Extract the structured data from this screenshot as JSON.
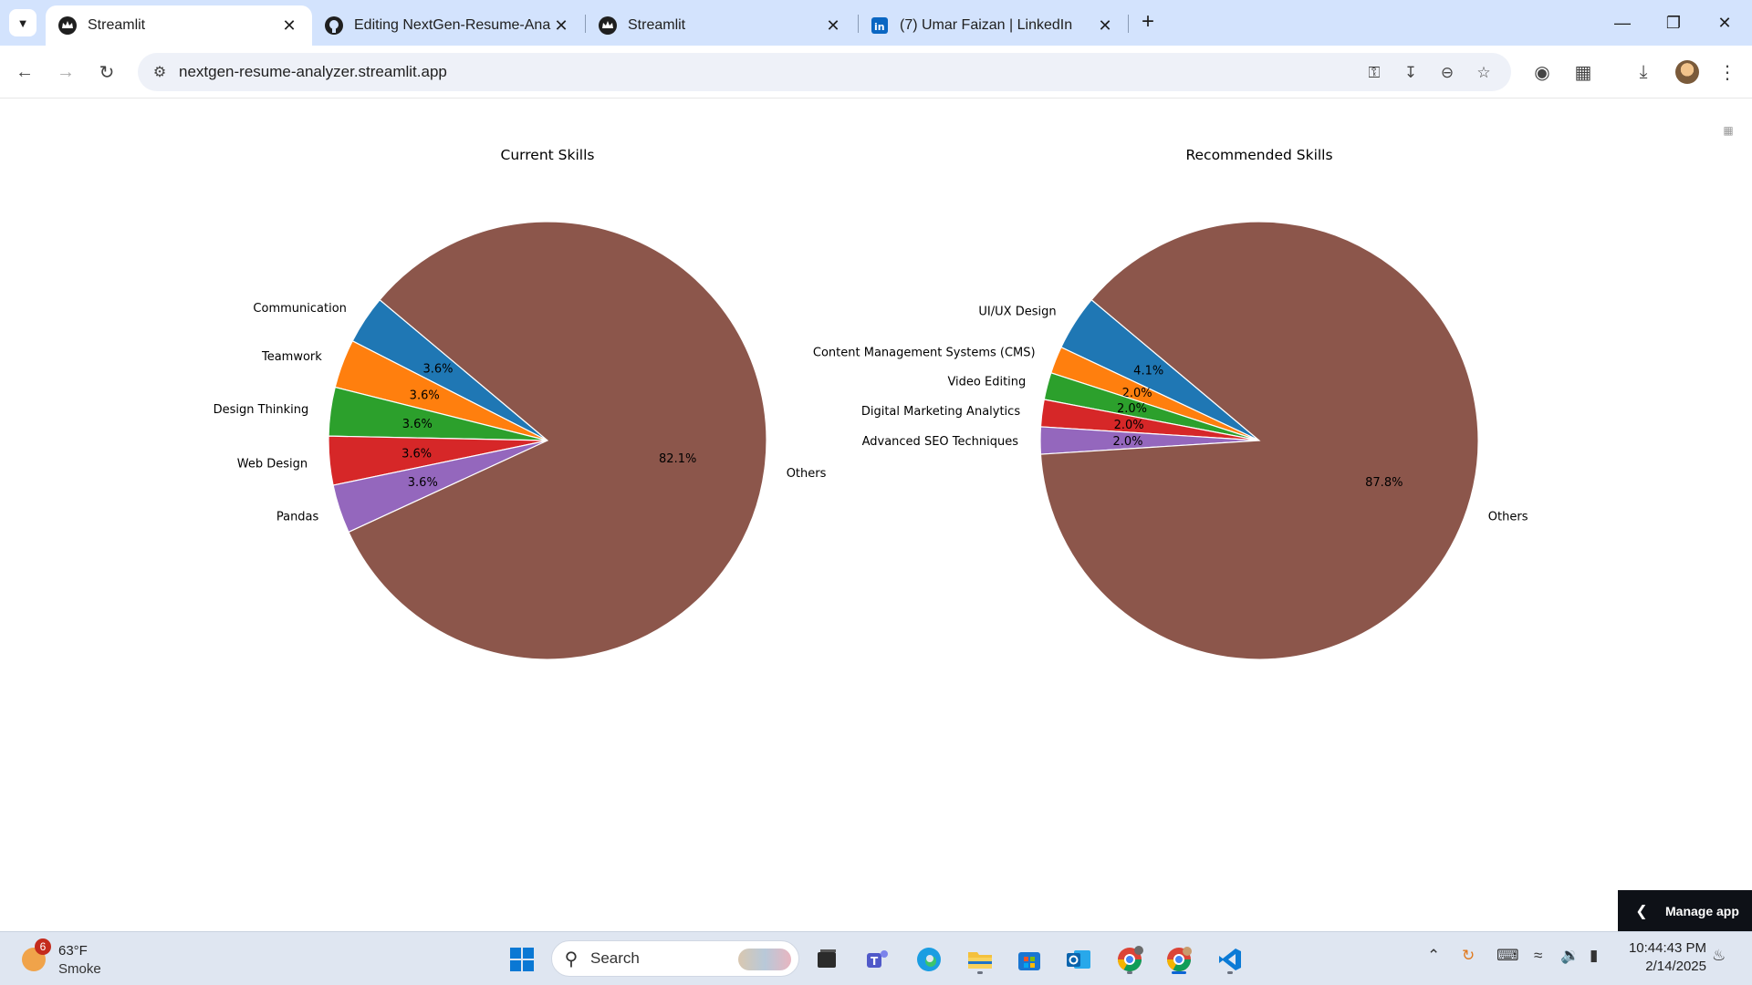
{
  "browser": {
    "tabs": [
      {
        "title": "Streamlit",
        "favicon": "streamlit-crown-icon",
        "active": true
      },
      {
        "title": "Editing NextGen-Resume-Analy",
        "favicon": "github-icon",
        "active": false
      },
      {
        "title": "Streamlit",
        "favicon": "streamlit-crown-icon",
        "active": false
      },
      {
        "title": "(7) Umar Faizan | LinkedIn",
        "favicon": "linkedin-icon",
        "active": false
      }
    ],
    "url": "nextgen-resume-analyzer.streamlit.app"
  },
  "app": {
    "manage_app_label": "Manage app"
  },
  "chart_data": [
    {
      "type": "pie",
      "title": "Current Skills",
      "labels": [
        "Communication",
        "Teamwork",
        "Design Thinking",
        "Web Design",
        "Pandas",
        "Others"
      ],
      "values": [
        3.6,
        3.6,
        3.6,
        3.6,
        3.6,
        82.1
      ],
      "value_labels": [
        "3.6%",
        "3.6%",
        "3.6%",
        "3.6%",
        "3.6%",
        "82.1%"
      ],
      "colors": [
        "#1f77b4",
        "#ff7f0e",
        "#2ca02c",
        "#d62728",
        "#9467bd",
        "#8c564b"
      ],
      "start_angle_deg": 140
    },
    {
      "type": "pie",
      "title": "Recommended Skills",
      "labels": [
        "UI/UX Design",
        "Content Management Systems (CMS)",
        "Video Editing",
        "Digital Marketing Analytics",
        "Advanced SEO Techniques",
        "Others"
      ],
      "values": [
        4.1,
        2.0,
        2.0,
        2.0,
        2.0,
        87.8
      ],
      "value_labels": [
        "4.1%",
        "2.0%",
        "2.0%",
        "2.0%",
        "2.0%",
        "87.8%"
      ],
      "colors": [
        "#1f77b4",
        "#ff7f0e",
        "#2ca02c",
        "#d62728",
        "#9467bd",
        "#8c564b"
      ],
      "start_angle_deg": 140
    }
  ],
  "taskbar": {
    "weather": {
      "badge": "6",
      "temperature": "63°F",
      "condition": "Smoke"
    },
    "search_placeholder": "Search",
    "apps": [
      "windows-start-icon",
      "task-view-icon",
      "teams-icon",
      "edge-icon",
      "file-explorer-icon",
      "microsoft-store-icon",
      "outlook-icon",
      "chrome-profile-icon",
      "chrome-icon",
      "vscode-icon"
    ],
    "time": "10:44:43 PM",
    "date": "2/14/2025"
  }
}
